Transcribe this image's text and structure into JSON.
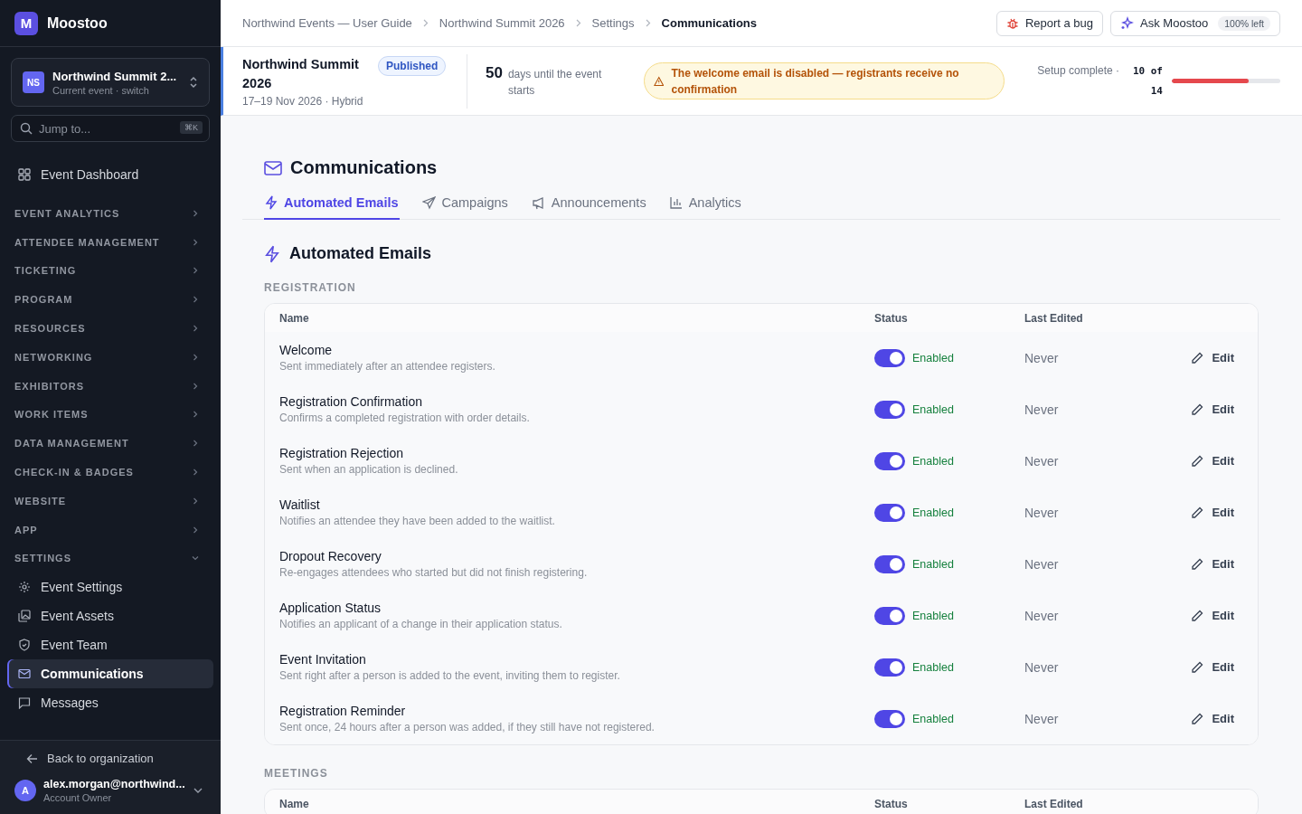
{
  "sidebar": {
    "brand": {
      "initial": "M",
      "name": "Moostoo"
    },
    "event_switcher": {
      "initials": "NS",
      "name": "Northwind Summit 2...",
      "subtitle": "Current event · switch"
    },
    "search": {
      "placeholder": "Jump to...",
      "shortcut": "⌘K"
    },
    "dashboard": {
      "label": "Event Dashboard",
      "selected": false
    },
    "sections": [
      {
        "label": "EVENT ANALYTICS",
        "expanded": false
      },
      {
        "label": "ATTENDEE MANAGEMENT",
        "expanded": false
      },
      {
        "label": "TICKETING",
        "expanded": false
      },
      {
        "label": "PROGRAM",
        "expanded": false
      },
      {
        "label": "RESOURCES",
        "expanded": false
      },
      {
        "label": "NETWORKING",
        "expanded": false
      },
      {
        "label": "EXHIBITORS",
        "expanded": false
      },
      {
        "label": "WORK ITEMS",
        "expanded": false
      },
      {
        "label": "DATA MANAGEMENT",
        "expanded": false
      },
      {
        "label": "CHECK-IN & BADGES",
        "expanded": false
      },
      {
        "label": "WEBSITE",
        "expanded": false
      },
      {
        "label": "APP",
        "expanded": false
      },
      {
        "label": "SETTINGS",
        "expanded": true,
        "children": [
          {
            "label": "Event Settings",
            "selected": false
          },
          {
            "label": "Event Assets",
            "selected": false
          },
          {
            "label": "Event Team",
            "selected": false
          },
          {
            "label": "Communications",
            "selected": true
          },
          {
            "label": "Messages",
            "selected": false
          }
        ]
      }
    ],
    "back_link": "Back to organization",
    "user": {
      "initial": "A",
      "email": "alex.morgan@northwind...",
      "role": "Account Owner"
    }
  },
  "header": {
    "breadcrumb": [
      "Northwind Events — User Guide",
      "Northwind Summit 2026",
      "Settings",
      "Communications"
    ],
    "report_button": "Report a bug",
    "ask_button": {
      "label": "Ask Moostoo",
      "badge": "100% left"
    }
  },
  "event_banner": {
    "title": "Northwind Summit 2026",
    "status": "Published",
    "dates": "17–19 Nov 2026 · Hybrid",
    "countdown": {
      "value": "50",
      "label": "days until the event starts"
    },
    "alert": "The welcome email is disabled — registrants receive no confirmation",
    "setup": {
      "label": "Setup complete ·",
      "count": "10 of 14",
      "level": 0.71
    }
  },
  "page": {
    "title": "Communications",
    "tabs": [
      {
        "label": "Automated Emails",
        "selected": true
      },
      {
        "label": "Campaigns",
        "selected": false
      },
      {
        "label": "Announcements",
        "selected": false
      },
      {
        "label": "Analytics",
        "selected": false
      }
    ],
    "section_title": "Automated Emails",
    "groups": [
      {
        "heading": "REGISTRATION",
        "columns": [
          "Name",
          "Status",
          "Last Edited"
        ],
        "rows": [
          {
            "name": "Welcome",
            "description": "Sent immediately after an attendee registers.",
            "enabled": true,
            "status": "Enabled",
            "last_edited": "Never",
            "action": "Edit"
          },
          {
            "name": "Registration Confirmation",
            "description": "Confirms a completed registration with order details.",
            "enabled": true,
            "status": "Enabled",
            "last_edited": "Never",
            "action": "Edit"
          },
          {
            "name": "Registration Rejection",
            "description": "Sent when an application is declined.",
            "enabled": true,
            "status": "Enabled",
            "last_edited": "Never",
            "action": "Edit"
          },
          {
            "name": "Waitlist",
            "description": "Notifies an attendee they have been added to the waitlist.",
            "enabled": true,
            "status": "Enabled",
            "last_edited": "Never",
            "action": "Edit"
          },
          {
            "name": "Dropout Recovery",
            "description": "Re-engages attendees who started but did not finish registering.",
            "enabled": true,
            "status": "Enabled",
            "last_edited": "Never",
            "action": "Edit"
          },
          {
            "name": "Application Status",
            "description": "Notifies an applicant of a change in their application status.",
            "enabled": true,
            "status": "Enabled",
            "last_edited": "Never",
            "action": "Edit"
          },
          {
            "name": "Event Invitation",
            "description": "Sent right after a person is added to the event, inviting them to register.",
            "enabled": true,
            "status": "Enabled",
            "last_edited": "Never",
            "action": "Edit"
          },
          {
            "name": "Registration Reminder",
            "description": "Sent once, 24 hours after a person was added, if they still have not registered.",
            "enabled": true,
            "status": "Enabled",
            "last_edited": "Never",
            "action": "Edit"
          }
        ]
      },
      {
        "heading": "MEETINGS",
        "columns": [
          "Name",
          "Status",
          "Last Edited"
        ]
      }
    ]
  }
}
